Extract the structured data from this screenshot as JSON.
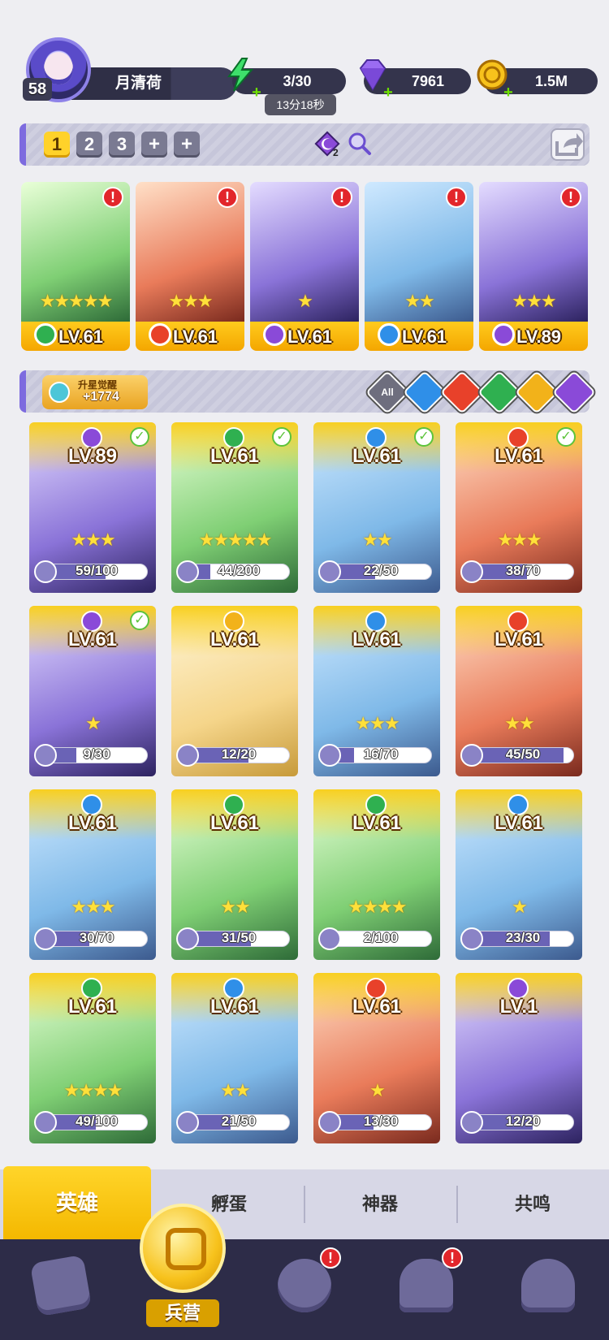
{
  "player": {
    "name": "月清荷",
    "level": "58"
  },
  "resources": {
    "energy": "3/30",
    "energy_timer": "13分18秒",
    "gems": "7961",
    "coins": "1.5M"
  },
  "teams": {
    "tabs": [
      "1",
      "2",
      "3",
      "+",
      "+"
    ],
    "active": "1",
    "element_badge": "2"
  },
  "formation": [
    {
      "element": "grass",
      "stars": 5,
      "level": "LV.61",
      "alert": "!"
    },
    {
      "element": "fire",
      "stars": 3,
      "level": "LV.61",
      "alert": "!"
    },
    {
      "element": "dark",
      "stars": 1,
      "level": "LV.61",
      "alert": "!"
    },
    {
      "element": "water",
      "stars": 2,
      "level": "LV.61",
      "alert": "!"
    },
    {
      "element": "dark",
      "stars": 3,
      "level": "LV.89",
      "alert": "!"
    }
  ],
  "filter": {
    "awaken_label": "升星觉醒",
    "awaken_count": "+1774",
    "buttons": [
      "All",
      "water",
      "fire",
      "grass",
      "light",
      "dark"
    ],
    "all_label": "All"
  },
  "heroes": [
    {
      "element": "dark",
      "level": "LV.89",
      "stars": 3,
      "shards": "59/100",
      "progress": 0.59,
      "checked": true
    },
    {
      "element": "grass",
      "level": "LV.61",
      "stars": 5,
      "shards": "44/200",
      "progress": 0.22,
      "checked": true
    },
    {
      "element": "water",
      "level": "LV.61",
      "stars": 2,
      "shards": "22/50",
      "progress": 0.44,
      "checked": true
    },
    {
      "element": "fire",
      "level": "LV.61",
      "stars": 3,
      "shards": "38/70",
      "progress": 0.54,
      "checked": true
    },
    {
      "element": "dark",
      "level": "LV.61",
      "stars": 1,
      "shards": "9/30",
      "progress": 0.3,
      "checked": true
    },
    {
      "element": "light",
      "level": "LV.61",
      "stars": 0,
      "shards": "12/20",
      "progress": 0.6,
      "checked": false
    },
    {
      "element": "water",
      "level": "LV.61",
      "stars": 3,
      "shards": "16/70",
      "progress": 0.23,
      "checked": false
    },
    {
      "element": "fire",
      "level": "LV.61",
      "stars": 2,
      "shards": "45/50",
      "progress": 0.9,
      "checked": false
    },
    {
      "element": "water",
      "level": "LV.61",
      "stars": 3,
      "shards": "30/70",
      "progress": 0.43,
      "checked": false
    },
    {
      "element": "grass",
      "level": "LV.61",
      "stars": 2,
      "shards": "31/50",
      "progress": 0.62,
      "checked": false
    },
    {
      "element": "grass",
      "level": "LV.61",
      "stars": 4,
      "shards": "2/100",
      "progress": 0.02,
      "checked": false
    },
    {
      "element": "water",
      "level": "LV.61",
      "stars": 1,
      "shards": "23/30",
      "progress": 0.77,
      "checked": false
    },
    {
      "element": "grass",
      "level": "LV.61",
      "stars": 4,
      "shards": "49/100",
      "progress": 0.49,
      "checked": false
    },
    {
      "element": "water",
      "level": "LV.61",
      "stars": 2,
      "shards": "21/50",
      "progress": 0.42,
      "checked": false
    },
    {
      "element": "fire",
      "level": "LV.61",
      "stars": 1,
      "shards": "13/30",
      "progress": 0.43,
      "checked": false
    },
    {
      "element": "dark",
      "level": "LV.1",
      "stars": 0,
      "shards": "12/20",
      "progress": 0.6,
      "checked": false
    }
  ],
  "subtabs": [
    "英雄",
    "孵蛋",
    "神器",
    "共鸣"
  ],
  "nav": {
    "active_label": "兵营",
    "items": [
      "cards",
      "barracks",
      "map",
      "shrine",
      "mushroom"
    ]
  },
  "colors": {
    "water": "#2f8fe8",
    "fire": "#e8412a",
    "grass": "#2fb050",
    "light": "#f2b21a",
    "dark": "#8a4ad8",
    "gold": "#f7c21c",
    "accent": "#7d6bdf"
  }
}
